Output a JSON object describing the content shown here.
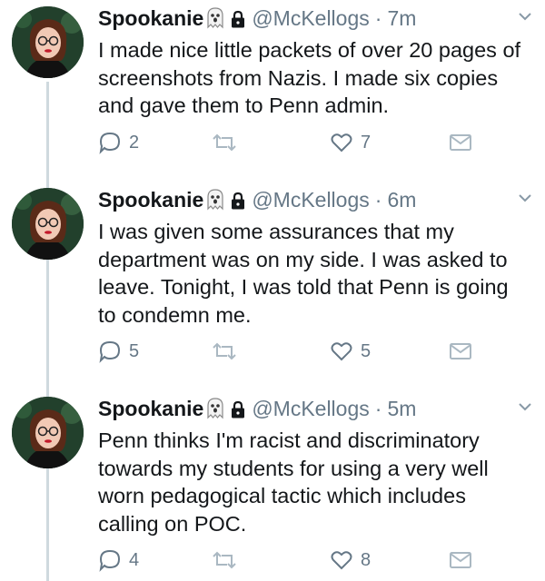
{
  "tweets": [
    {
      "name": "Spookanie",
      "handle": "@McKellogs",
      "separator": "·",
      "time": "7m",
      "text": "I made nice little packets of over 20 pages of screenshots from Nazis. I made six copies and gave them to Penn admin.",
      "replies": "2",
      "likes": "7"
    },
    {
      "name": "Spookanie",
      "handle": "@McKellogs",
      "separator": "·",
      "time": "6m",
      "text": "I was given some assurances that my department was on my side. I was asked to leave. Tonight, I was told that Penn is going to condemn me.",
      "replies": "5",
      "likes": "5"
    },
    {
      "name": "Spookanie",
      "handle": "@McKellogs",
      "separator": "·",
      "time": "5m",
      "text": "Penn thinks I'm racist and discriminatory towards my students for using a very well worn pedagogical tactic which includes calling on POC.",
      "replies": "4",
      "likes": "8"
    }
  ],
  "icons": {
    "name_emoji": "ghost-icon",
    "protected": "lock-icon",
    "menu": "chevron-down-icon",
    "reply": "reply-icon",
    "retweet": "retweet-icon",
    "like": "heart-icon",
    "dm": "envelope-icon"
  },
  "colors": {
    "text": "#14171a",
    "muted": "#657786",
    "icon": "#657786",
    "thread_line": "#cfd9de",
    "background": "#ffffff"
  }
}
